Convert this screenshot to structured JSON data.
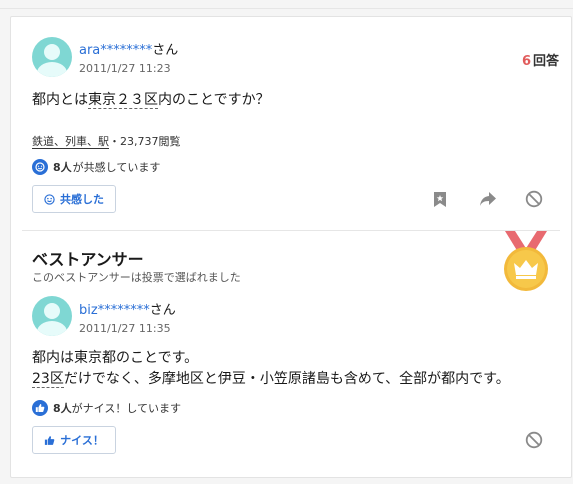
{
  "question": {
    "user_id": "ara********",
    "user_suffix": "さん",
    "date": "2011/1/27 11:23",
    "answer_count": "6",
    "answer_count_label": "回答",
    "text_before": "都内とは",
    "text_keyword": "東京２３区",
    "text_after": "内のことですか？",
    "categories": [
      "鉄道、列車、駅"
    ],
    "views": "23,737閲覧",
    "empathy_count": "8人",
    "empathy_text": "が共感しています",
    "empathy_button": "共感した",
    "icons": [
      "bookmark-icon",
      "share-icon",
      "report-icon"
    ]
  },
  "best_answer": {
    "title": "ベストアンサー",
    "subtitle": "このベストアンサーは投票で選ばれました",
    "user_id": "biz********",
    "user_suffix": "さん",
    "date": "2011/1/27 11:35",
    "line1": "都内は東京都のことです。",
    "line2_keyword": "23区",
    "line2_rest": "だけでなく、多摩地区と伊豆・小笠原諸島も含めて、全部が都内です。",
    "nice_count": "8人",
    "nice_text": "がナイス！しています",
    "nice_button": "ナイス！",
    "colors": {
      "accent": "#2a6fd6",
      "medal_gold": "#f7c84a",
      "ribbon": "#e86a70"
    }
  }
}
